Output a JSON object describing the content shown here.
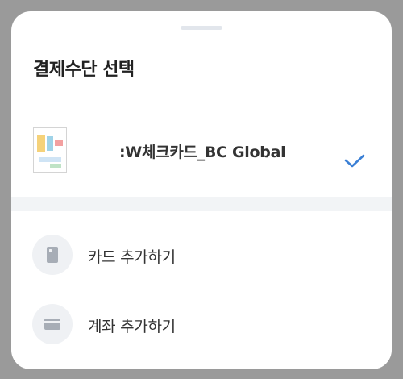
{
  "sheet": {
    "title": "결제수단 선택"
  },
  "selected_card": {
    "name": ":W체크카드_BC Global",
    "icon": "check-icon",
    "accent_color": "#3a7fd5"
  },
  "actions": [
    {
      "label": "카드 추가하기",
      "icon": "card-icon"
    },
    {
      "label": "계좌 추가하기",
      "icon": "bank-account-icon"
    }
  ]
}
